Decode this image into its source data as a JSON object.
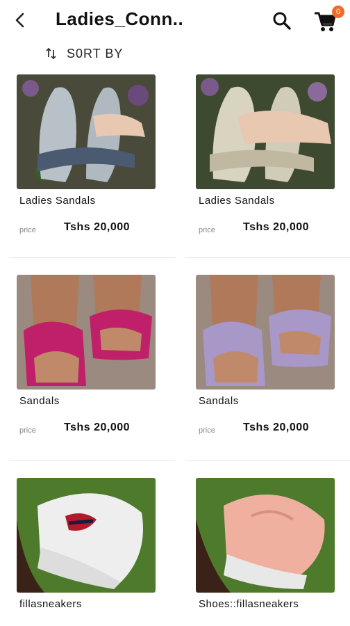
{
  "header": {
    "title": "Ladies_Conn..",
    "cart_count": "0"
  },
  "sort": {
    "label": "S0RT BY"
  },
  "products": [
    {
      "name": "Ladies Sandals",
      "price_label": "price",
      "price": "Tshs 20,000"
    },
    {
      "name": "Ladies Sandals",
      "price_label": "price",
      "price": "Tshs 20,000"
    },
    {
      "name": "Sandals",
      "price_label": "price",
      "price": "Tshs 20,000"
    },
    {
      "name": "Sandals",
      "price_label": "price",
      "price": "Tshs 20,000"
    },
    {
      "name": "fillasneakers"
    },
    {
      "name": "Shoes::fillasneakers"
    }
  ],
  "colors": {
    "accent": "#f26b2a",
    "text": "#111111",
    "muted": "#888888"
  }
}
